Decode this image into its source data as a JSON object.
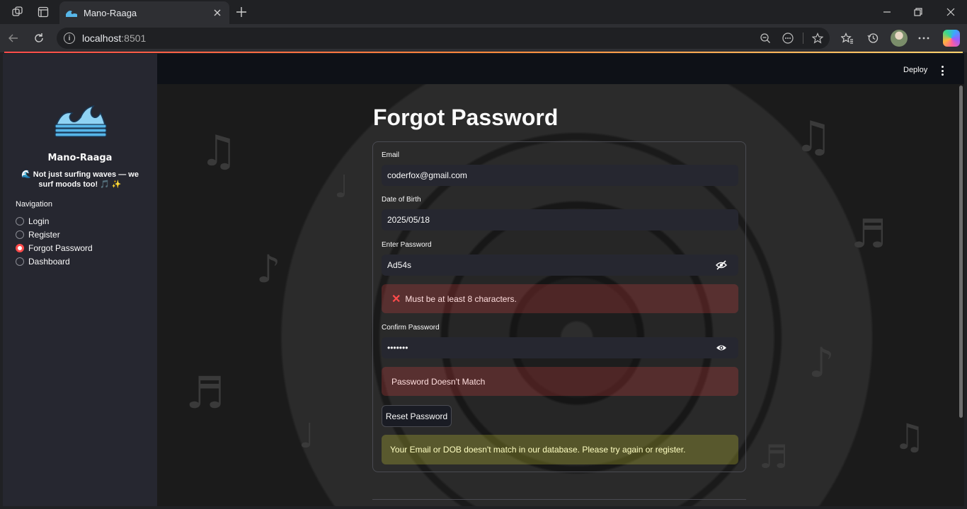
{
  "browser": {
    "tab_title": "Mano-Raaga",
    "url_host": "localhost",
    "url_port": ":8501"
  },
  "sidebar": {
    "app_name": "Mano-Raaga",
    "tagline": "🌊 Not just surfing waves — we surf moods too! 🎵 ✨",
    "nav_title": "Navigation",
    "items": [
      {
        "label": "Login",
        "selected": false
      },
      {
        "label": "Register",
        "selected": false
      },
      {
        "label": "Forgot Password",
        "selected": true
      },
      {
        "label": "Dashboard",
        "selected": false
      }
    ]
  },
  "header": {
    "deploy_label": "Deploy"
  },
  "form": {
    "title": "Forgot Password",
    "email_label": "Email",
    "email_value": "coderfox@gmail.com",
    "dob_label": "Date of Birth",
    "dob_value": "2025/05/18",
    "password_label": "Enter Password",
    "password_value": "Ad54s",
    "password_error": "Must be at least 8 characters.",
    "confirm_label": "Confirm Password",
    "confirm_value": "•••••••",
    "confirm_error": "Password Doesn't Match",
    "reset_button": "Reset Password",
    "warning": "Your Email or DOB doesn't match in our database. Please try again or register."
  },
  "colors": {
    "accent": "#ff4b4b",
    "sidebar_bg": "#262730",
    "main_bg": "#0e1117"
  }
}
